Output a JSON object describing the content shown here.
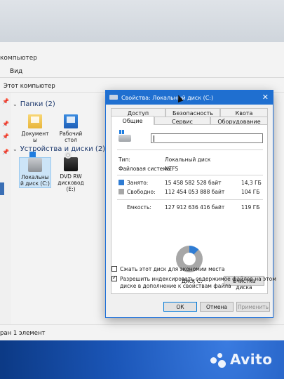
{
  "explorer": {
    "title_fragment": "компьютер",
    "menu_view": "Вид",
    "address": "Этот компьютер",
    "folders_group": "Папки (2)",
    "folders": [
      {
        "label_line1": "Документ",
        "label_line2": "ы"
      },
      {
        "label_line1": "Рабочий",
        "label_line2": "стол"
      }
    ],
    "devices_group": "Устройства и диски (2)",
    "devices": [
      {
        "label_line1": "Локальны",
        "label_line2": "й диск (C:)"
      },
      {
        "label_line1": "DVD RW",
        "label_line2": "дисковод",
        "label_line3": "(E:)"
      }
    ],
    "status": "ран 1 элемент"
  },
  "dialog": {
    "title": "Свойства: Локальный диск (C:)",
    "tabs_row1": [
      "Доступ",
      "Безопасность",
      "Квота"
    ],
    "tabs_row2": [
      "Общие",
      "Сервис",
      "Оборудование"
    ],
    "type_label": "Тип:",
    "type_value": "Локальный диск",
    "fs_label": "Файловая система:",
    "fs_value": "NTFS",
    "used_label": "Занято:",
    "used_bytes": "15 458 582 528 байт",
    "used_size": "14,3 ГБ",
    "free_label": "Свободно:",
    "free_bytes": "112 454 053 888 байт",
    "free_size": "104 ГБ",
    "capacity_label": "Емкость:",
    "capacity_bytes": "127 912 636 416 байт",
    "capacity_size": "119 ГБ",
    "disk_label": "Диск C:",
    "cleanup_button": "Очистка диска",
    "compress_label": "Сжать этот диск для экономии места",
    "compress_checked": false,
    "index_label_line1": "Разрешить индексировать содержимое файлов на этом",
    "index_label_line2": "диске в дополнение к свойствам файла",
    "index_checked": true,
    "ok_button": "ОК",
    "cancel_button": "Отмена",
    "apply_button": "Применить",
    "used_fraction": 0.121,
    "used_color": "#2f7cd3",
    "free_color": "#a7a7a7"
  },
  "watermark": "Avito"
}
